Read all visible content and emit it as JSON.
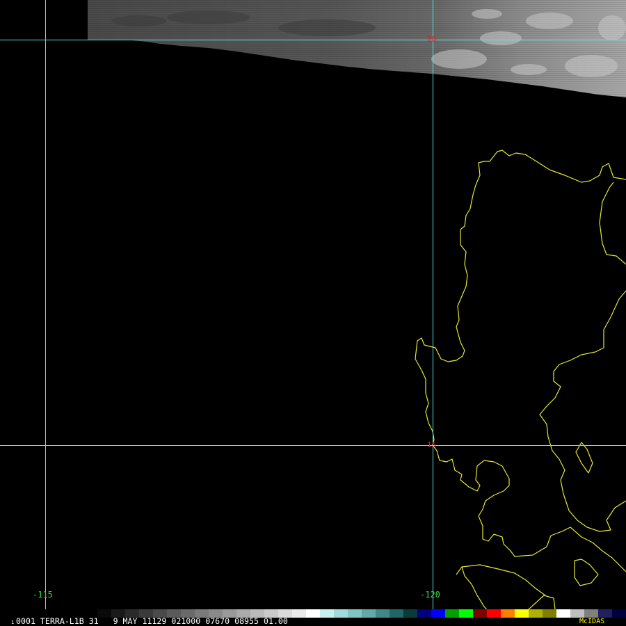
{
  "header": {
    "frame_prefix": "1",
    "text": "0001 TERRA-L1B 31   9 MAY 11129 021000 07670 08955 01.00",
    "brand": "McIDAS",
    "text_color": "#ffffff",
    "brand_color": "#ffff00"
  },
  "grid": {
    "line_color": "#5fe0e0",
    "lon_label_color": "#33dd33",
    "lat_label_color": "#dd2222",
    "lon_labels": [
      "-115",
      "-120"
    ],
    "lat_labels": [
      "20",
      "15"
    ]
  },
  "map": {
    "background_color": "#000000",
    "coast_color": "#e8e830",
    "cloud_color": "#8a8a8a"
  },
  "colorbar": {
    "colors": [
      "#0a0a0a",
      "#1a1a1a",
      "#2a2a2a",
      "#3a3a3a",
      "#4a4a4a",
      "#5a5a5a",
      "#6a6a6a",
      "#7a7a7a",
      "#8a8a8a",
      "#9a9a9a",
      "#aaaaaa",
      "#bababa",
      "#cacaca",
      "#dadada",
      "#eaeaea",
      "#ffffff",
      "#c8f0f0",
      "#a0dada",
      "#80c4c4",
      "#60aaaa",
      "#408888",
      "#206666",
      "#0a3a3a",
      "#000080",
      "#0000ff",
      "#00a000",
      "#00ff00",
      "#800000",
      "#ff0000",
      "#ff8000",
      "#ffff00",
      "#b0b000",
      "#808000",
      "#ffffff",
      "#c0c0c0",
      "#808080",
      "#202060",
      "#000040"
    ]
  }
}
